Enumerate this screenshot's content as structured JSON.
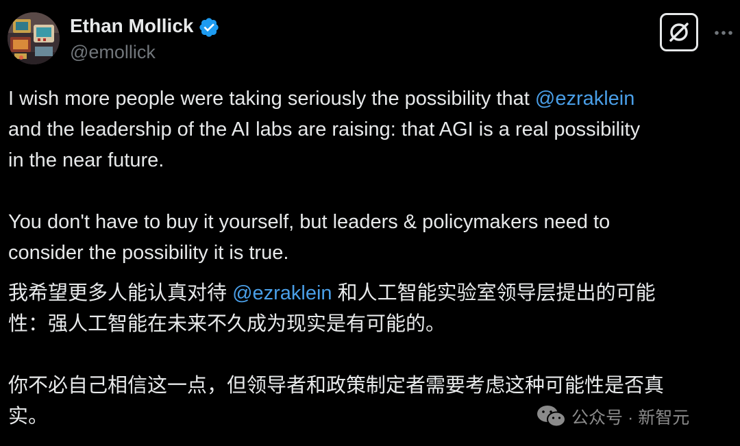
{
  "author": {
    "name": "Ethan Mollick",
    "handle": "@emollick",
    "verified": true,
    "avatar": "avatar-image"
  },
  "actions": {
    "x_icon": "x-logo-icon",
    "more_icon": "more-options-icon"
  },
  "colors": {
    "background": "#000000",
    "text": "#e7e9ea",
    "secondary": "#71767b",
    "mention": "#4a9fe8",
    "verified": "#1d9bf0"
  },
  "body_en": {
    "l1_pre": "I wish more people were taking seriously the possibility that ",
    "l1_mention": "@ezraklein",
    "l2": "and the leadership of the AI labs are raising: that AGI is a real possibility",
    "l3": "in the near future.",
    "l4": "You don't have to buy it yourself, but leaders & policymakers need to",
    "l5": "consider the possibility it is true."
  },
  "body_zh": {
    "l1_pre": "我希望更多人能认真对待 ",
    "l1_mention": "@ezraklein",
    "l1_post": " 和人工智能实验室领导层提出的可能",
    "l2": "性：强人工智能在未来不久成为现实是有可能的。",
    "l3": "你不必自己相信这一点，但领导者和政策制定者需要考虑这种可能性是否真",
    "l4": "实。"
  },
  "watermark": {
    "text": "公众号 · 新智元",
    "icon": "wechat-icon"
  }
}
